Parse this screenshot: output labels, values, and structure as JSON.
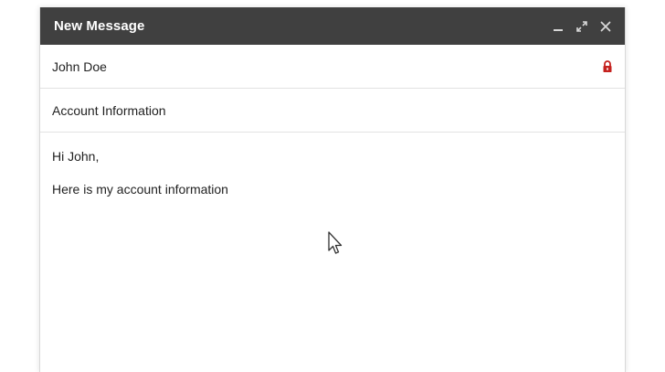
{
  "compose": {
    "title": "New Message",
    "window_controls": [
      {
        "name": "minimize-icon"
      },
      {
        "name": "expand-icon"
      },
      {
        "name": "close-icon"
      }
    ],
    "to": {
      "value": "John Doe",
      "icon": "lock-icon",
      "icon_color": "#c5221f"
    },
    "subject": {
      "value": "Account Information"
    },
    "body": {
      "lines": [
        "Hi John,",
        "Here is my account information"
      ]
    }
  },
  "colors": {
    "titlebar": "#404040",
    "text": "#222222",
    "lock": "#c5221f"
  }
}
